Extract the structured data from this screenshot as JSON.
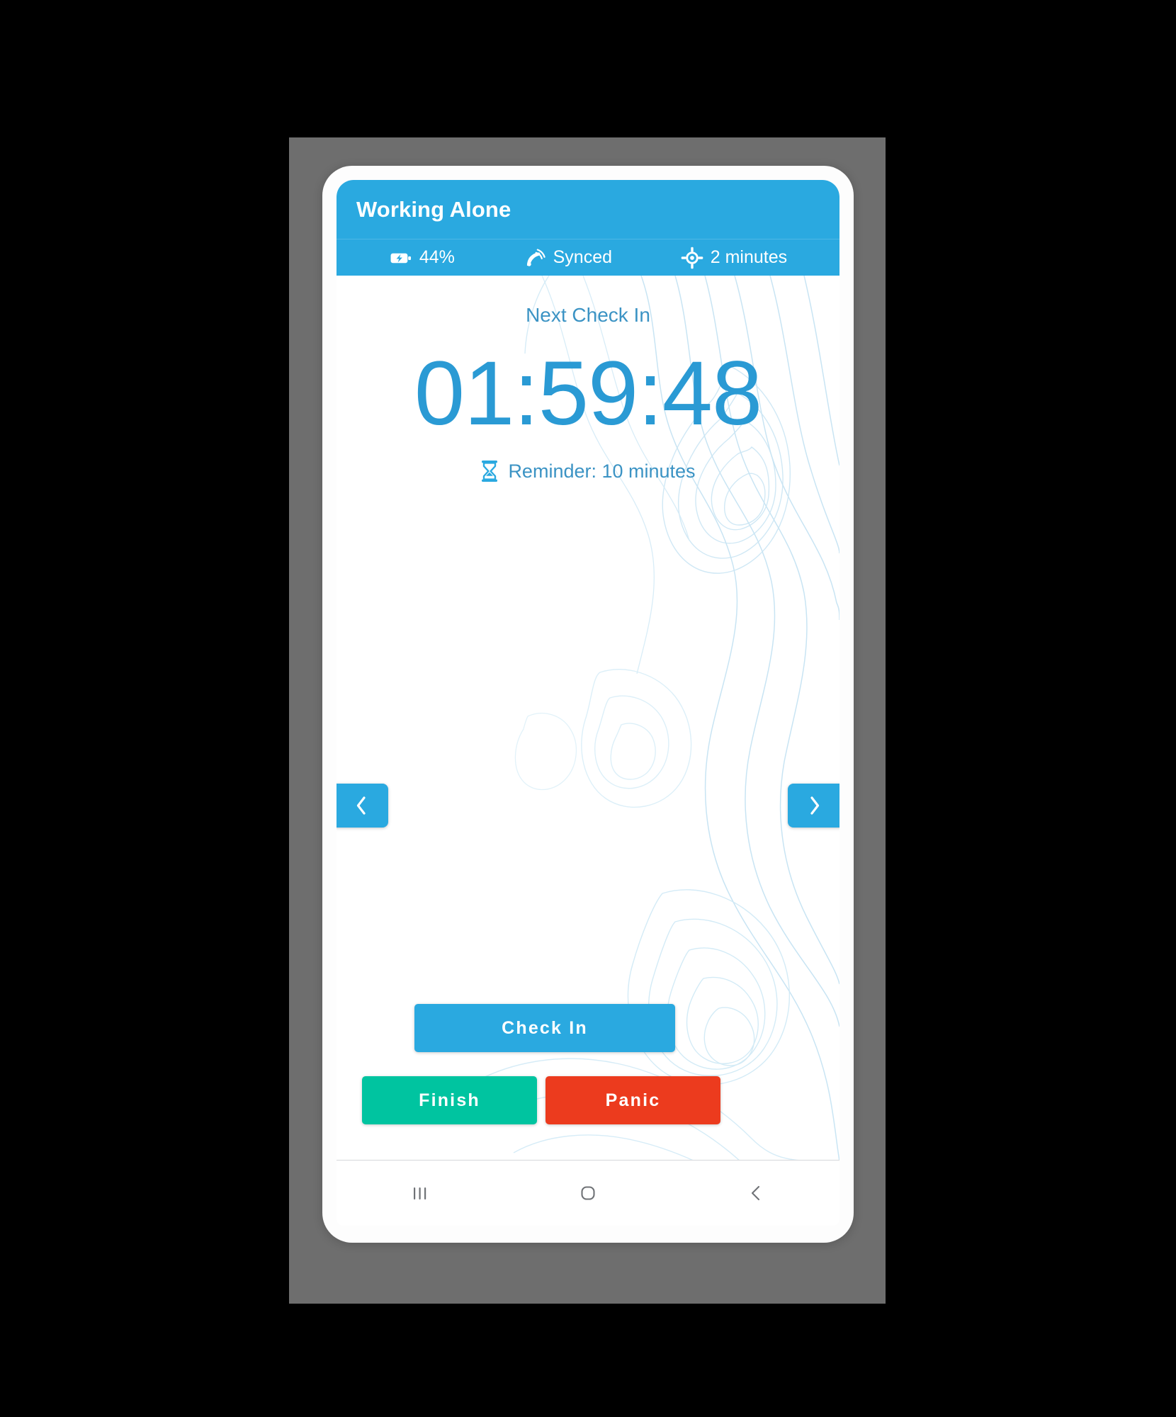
{
  "app": {
    "title": "Working Alone",
    "accent_blue": "#2aa9e0",
    "text_blue": "#3b93c4",
    "finish_green": "#00c4a0",
    "panic_red": "#ec3b1e",
    "frame_gray": "#6e6e6e",
    "page_background": "#000000"
  },
  "status_strip": {
    "items": [
      {
        "icon": "battery-charging-icon",
        "label": "44%"
      },
      {
        "icon": "satellite-dish-icon",
        "label": "Synced"
      },
      {
        "icon": "gps-crosshair-icon",
        "label": "2 minutes"
      }
    ]
  },
  "main": {
    "next_check_in_label": "Next Check In",
    "timer": "01:59:48",
    "reminder_icon": "hourglass-icon",
    "reminder_text": "Reminder: 10 minutes"
  },
  "nav_arrows": {
    "previous_icon": "chevron-left-icon",
    "next_icon": "chevron-right-icon"
  },
  "actions": {
    "check_in_label": "Check In",
    "finish_label": "Finish",
    "panic_label": "Panic"
  },
  "android_navbar": {
    "recents_icon": "recents-bars-icon",
    "home_icon": "home-square-icon",
    "back_icon": "back-chevron-icon"
  }
}
